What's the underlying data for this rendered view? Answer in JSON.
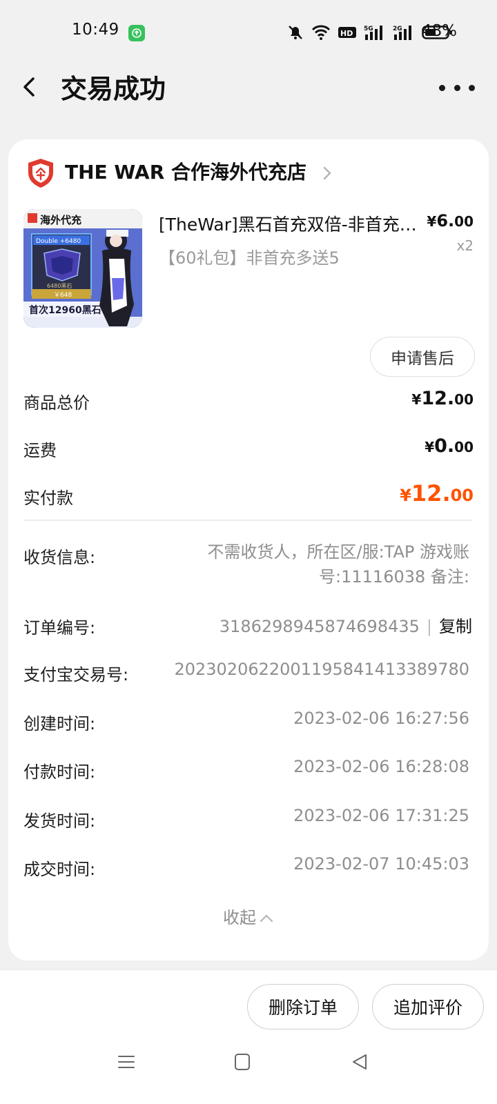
{
  "status_bar": {
    "time": "10:49",
    "battery": "48%"
  },
  "header": {
    "title": "交易成功"
  },
  "shop": {
    "name": "THE WAR 合作海外代充店",
    "icon": "shield-icon"
  },
  "product": {
    "title": "[TheWar]黑石首充双倍-非首充多送",
    "spec": "【60礼包】非首充多送5",
    "price_currency": "¥",
    "price_int": "6.",
    "price_dec": "00",
    "quantity": "x2",
    "thumb_texts": {
      "banner": "海外代充",
      "badge": "Double +6480",
      "sub": "6480黑石",
      "price": "￥648",
      "bottom": "首次12960黑石"
    }
  },
  "after_sale_label": "申请售后",
  "summary": {
    "goods_total_label": "商品总价",
    "goods_total": {
      "cur": "¥",
      "int": "12.",
      "dec": "00"
    },
    "shipping_label": "运费",
    "shipping": {
      "cur": "¥",
      "int": "0.",
      "dec": "00"
    },
    "paid_label": "实付款",
    "paid": {
      "cur": "¥",
      "int": "12.",
      "dec": "00"
    }
  },
  "details": {
    "receipt_label": "收货信息:",
    "receipt_value": "不需收货人，所在区/服:TAP 游戏账号:11116038 备注:",
    "order_no_label": "订单编号:",
    "order_no": "3186298945874698435",
    "copy_sep": "|",
    "copy_label": "复制",
    "alipay_label": "支付宝交易号:",
    "alipay_no": "2023020622001195841413389780",
    "created_label": "创建时间:",
    "created": "2023-02-06 16:27:56",
    "paid_time_label": "付款时间:",
    "paid_time": "2023-02-06 16:28:08",
    "shipped_label": "发货时间:",
    "shipped": "2023-02-06 17:31:25",
    "closed_label": "成交时间:",
    "closed": "2023-02-07 10:45:03",
    "collapse_label": "收起"
  },
  "actions": {
    "delete_label": "删除订单",
    "review_label": "追加评价"
  },
  "colors": {
    "accent_price": "#ff5200",
    "shop_icon": "#e03a2f",
    "status_green": "#37c15c"
  }
}
